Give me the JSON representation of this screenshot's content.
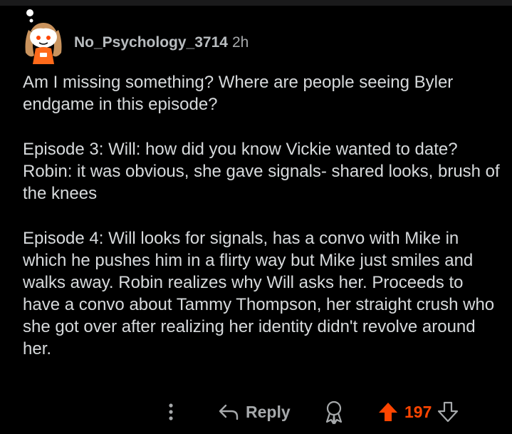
{
  "comment": {
    "author": "No_Psychology_3714",
    "age": "2h",
    "paragraphs": [
      "Am I missing something? Where are people seeing Byler endgame in this episode?",
      "Episode 3: Will: how did you know Vickie wanted to date? Robin: it was obvious, she gave signals- shared looks, brush of the knees",
      "Episode 4: Will looks for signals, has a convo with Mike in which he pushes him in a flirty way but Mike just smiles and walks away. Robin realizes why Will asks her. Proceeds to have a convo about Tammy Thompson, her straight crush who she got over after realizing her identity didn't revolve around her."
    ]
  },
  "actions": {
    "more_icon": "more-vertical-icon",
    "reply_icon": "reply-arrow-icon",
    "reply_label": "Reply",
    "award_icon": "award-icon",
    "upvote_icon": "upvote-arrow-icon",
    "score": "197",
    "downvote_icon": "downvote-arrow-icon"
  },
  "colors": {
    "background": "#000000",
    "text": "#d7dadc",
    "muted": "#a6a9ab",
    "upvote_active": "#ff4500"
  }
}
